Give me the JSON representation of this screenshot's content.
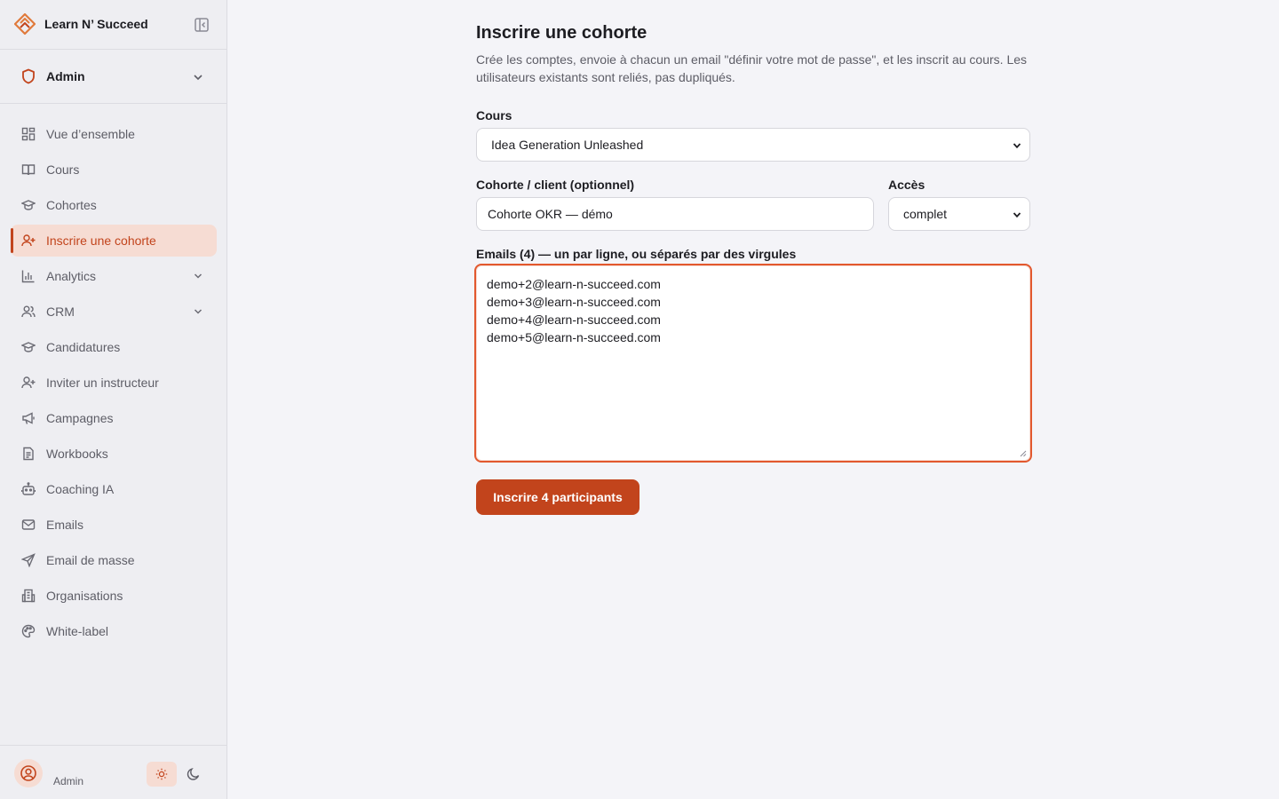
{
  "brand": {
    "name": "Learn N’ Succeed"
  },
  "role": {
    "label": "Admin"
  },
  "nav": [
    {
      "label": "Vue d’ensemble",
      "icon": "dashboard-icon"
    },
    {
      "label": "Cours",
      "icon": "book-icon"
    },
    {
      "label": "Cohortes",
      "icon": "graduation-cap-icon"
    },
    {
      "label": "Inscrire une cohorte",
      "icon": "user-plus-icon",
      "active": true
    },
    {
      "label": "Analytics",
      "icon": "bar-chart-icon",
      "expandable": true
    },
    {
      "label": "CRM",
      "icon": "users-icon",
      "expandable": true
    },
    {
      "label": "Candidatures",
      "icon": "graduation-cap-icon"
    },
    {
      "label": "Inviter un instructeur",
      "icon": "user-plus-icon"
    },
    {
      "label": "Campagnes",
      "icon": "megaphone-icon"
    },
    {
      "label": "Workbooks",
      "icon": "document-icon"
    },
    {
      "label": "Coaching IA",
      "icon": "robot-icon"
    },
    {
      "label": "Emails",
      "icon": "mail-icon"
    },
    {
      "label": "Email de masse",
      "icon": "send-icon"
    },
    {
      "label": "Organisations",
      "icon": "building-icon"
    },
    {
      "label": "White-label",
      "icon": "palette-icon"
    }
  ],
  "footer": {
    "user_name": "Admin"
  },
  "page": {
    "title": "Inscrire une cohorte",
    "description": "Crée les comptes, envoie à chacun un email \"définir votre mot de passe\", et les inscrit au cours. Les utilisateurs existants sont reliés, pas dupliqués."
  },
  "form": {
    "course_label": "Cours",
    "course_value": "Idea Generation Unleashed",
    "cohort_label": "Cohorte / client (optionnel)",
    "cohort_value": "Cohorte OKR — démo",
    "access_label": "Accès",
    "access_value": "complet",
    "emails_label": "Emails (4) — un par ligne, ou séparés par des virgules",
    "emails": [
      "demo+2@learn-n-succeed.com",
      "demo+3@learn-n-succeed.com",
      "demo+4@learn-n-succeed.com",
      "demo+5@learn-n-succeed.com"
    ],
    "submit_label": "Inscrire 4 participants"
  },
  "colors": {
    "accent": "#c2441c",
    "accent_soft": "#f6dcd3",
    "focus": "#e2582e"
  }
}
